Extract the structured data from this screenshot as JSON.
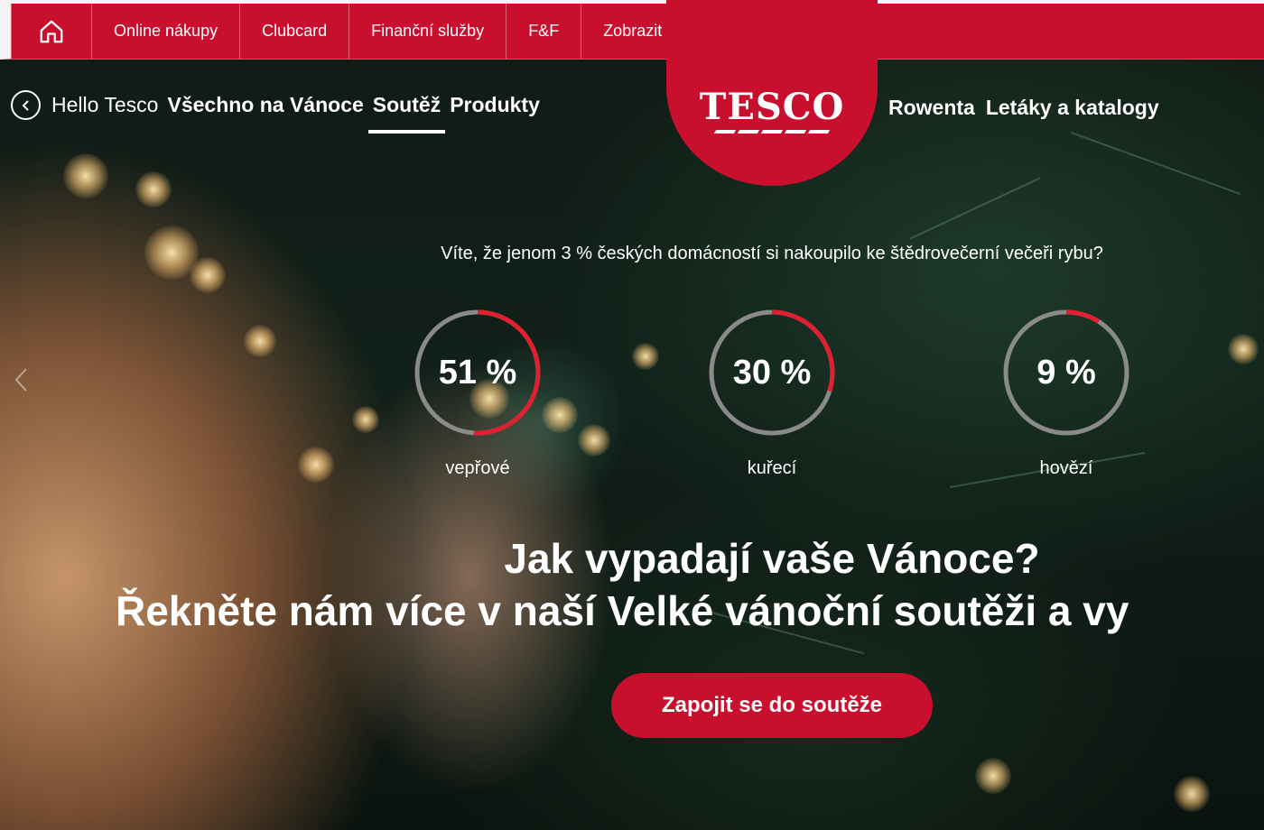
{
  "top_nav": {
    "items": [
      {
        "label": "Online nákupy"
      },
      {
        "label": "Clubcard"
      },
      {
        "label": "Finanční služby"
      },
      {
        "label": "F&F"
      },
      {
        "label": "Zobrazit víc"
      }
    ]
  },
  "sub_nav": {
    "back_label": "Hello Tesco",
    "left_links": [
      "Všechno na Vánoce",
      "Soutěž",
      "Produkty"
    ],
    "active": "Soutěž",
    "right_links": [
      "Rowenta",
      "Letáky a katalogy"
    ]
  },
  "logo": {
    "text": "TESCO"
  },
  "hero": {
    "fact": "Víte, že jenom 3 % českých domácností si nakoupilo ke štědrovečerní večeři rybu?",
    "stats": [
      {
        "value_text": "51 %",
        "value": 51,
        "label": "vepřové"
      },
      {
        "value_text": "30 %",
        "value": 30,
        "label": "kuřecí"
      },
      {
        "value_text": "9 %",
        "value": 9,
        "label": "hovězí"
      }
    ],
    "headline_1": "Jak vypadají vaše Vánoce?",
    "headline_2": "Řekněte nám více v naší Velké vánoční soutěži a vy",
    "cta_label": "Zapojit se do soutěže"
  },
  "colors": {
    "brand": "#c8102e",
    "ring_track": "#8a8a8a",
    "ring_fill": "#e0202e"
  }
}
